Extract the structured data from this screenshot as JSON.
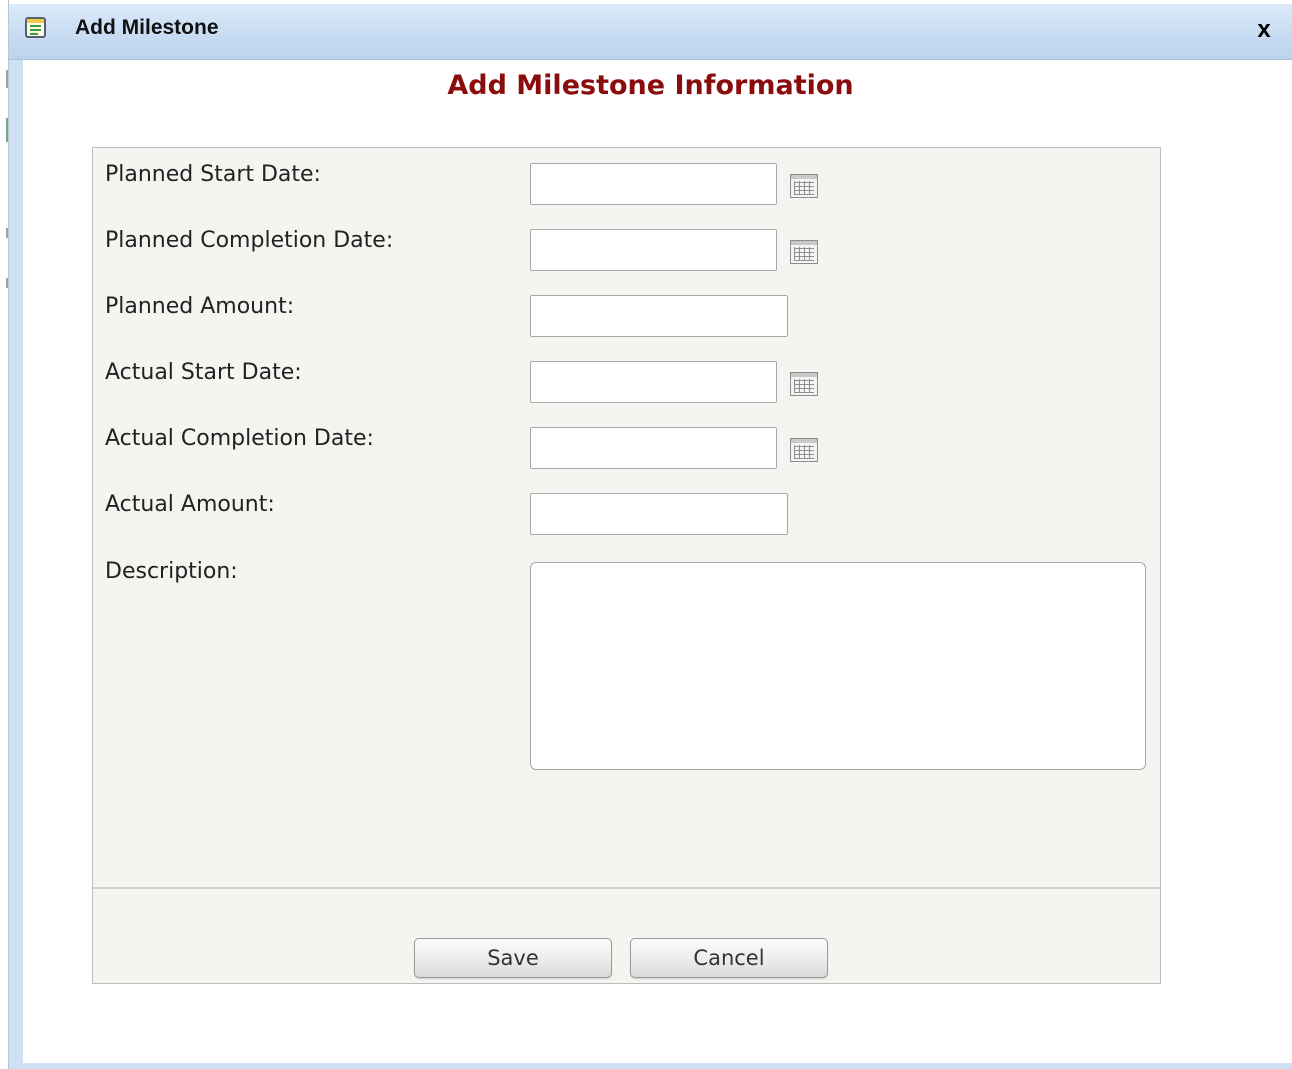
{
  "window": {
    "title": "Add Milestone",
    "close_label": "x"
  },
  "form": {
    "heading": "Add Milestone Information",
    "fields": [
      {
        "label": "Planned Start Date:",
        "value": "",
        "type": "date"
      },
      {
        "label": "Planned Completion Date:",
        "value": "",
        "type": "date"
      },
      {
        "label": "Planned Amount:",
        "value": "",
        "type": "amount"
      },
      {
        "label": "Actual Start Date:",
        "value": "",
        "type": "date"
      },
      {
        "label": "Actual Completion Date:",
        "value": "",
        "type": "date"
      },
      {
        "label": "Actual Amount:",
        "value": "",
        "type": "amount"
      }
    ],
    "description": {
      "label": "Description:",
      "value": ""
    },
    "buttons": {
      "save": "Save",
      "cancel": "Cancel"
    }
  },
  "icons": {
    "window": "form-window-icon",
    "calendar": "calendar-icon",
    "close": "close-icon"
  },
  "colors": {
    "heading": "#8b0c0c",
    "titlebar": "#c8dcf2",
    "panel": "#f5f4f1"
  }
}
